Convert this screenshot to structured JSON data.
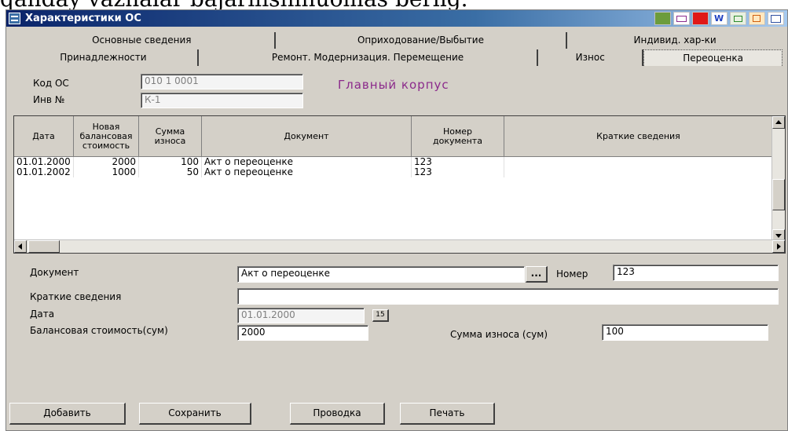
{
  "document_header_text": "qanday vaznalar bajarilishinuomas berlig.",
  "window": {
    "title": "Характеристики ОС",
    "toolbar_icons": [
      "green-page-icon",
      "mail-envelope-icon",
      "red-square-icon",
      "word-doc-icon",
      "excel-sheet-icon",
      "orange-doc-icon",
      "grid-chart-icon"
    ]
  },
  "tabs_row1": [
    "Основные сведения",
    "Оприходование/Выбытие",
    "Индивид. хар-ки"
  ],
  "tabs_row2": [
    "Принадлежности",
    "Ремонт. Модернизация. Перемещение",
    "Износ",
    "Переоценка"
  ],
  "header_fields": {
    "code_label": "Код ОС",
    "code_value": "010 1 0001",
    "inv_label": "Инв №",
    "inv_value": "К-1",
    "object_name": "Главный корпус"
  },
  "table": {
    "columns": [
      "Дата",
      "Новая\nбалансовая\nстоимость",
      "Сумма\nизноса",
      "Документ",
      "Номер\nдокумента",
      "Краткие сведения"
    ],
    "rows": [
      [
        "01.01.2000",
        "2000",
        "100",
        "Акт о переоценке",
        "123",
        ""
      ],
      [
        "01.01.2002",
        "1000",
        "50",
        "Акт о переоценке",
        "123",
        ""
      ]
    ]
  },
  "form": {
    "document_label": "Документ",
    "document_value": "Акт о переоценке",
    "lookup_button": "...",
    "number_label": "Номер",
    "number_value": "123",
    "notes_label": "Краткие сведения",
    "notes_value": "",
    "date_label": "Дата",
    "date_value": "01.01.2000",
    "calendar_button": "15",
    "balance_label": "Балансовая стоимость(сум)",
    "balance_value": "2000",
    "wear_label": "Сумма износа (сум)",
    "wear_value": "100"
  },
  "buttons": {
    "add": "Добавить",
    "save": "Сохранить",
    "post": "Проводка",
    "print": "Печать"
  },
  "colors": {
    "title_bar": "#0a246a",
    "object_name": "#8b2a8b",
    "window_bg": "#d4d0c8"
  }
}
